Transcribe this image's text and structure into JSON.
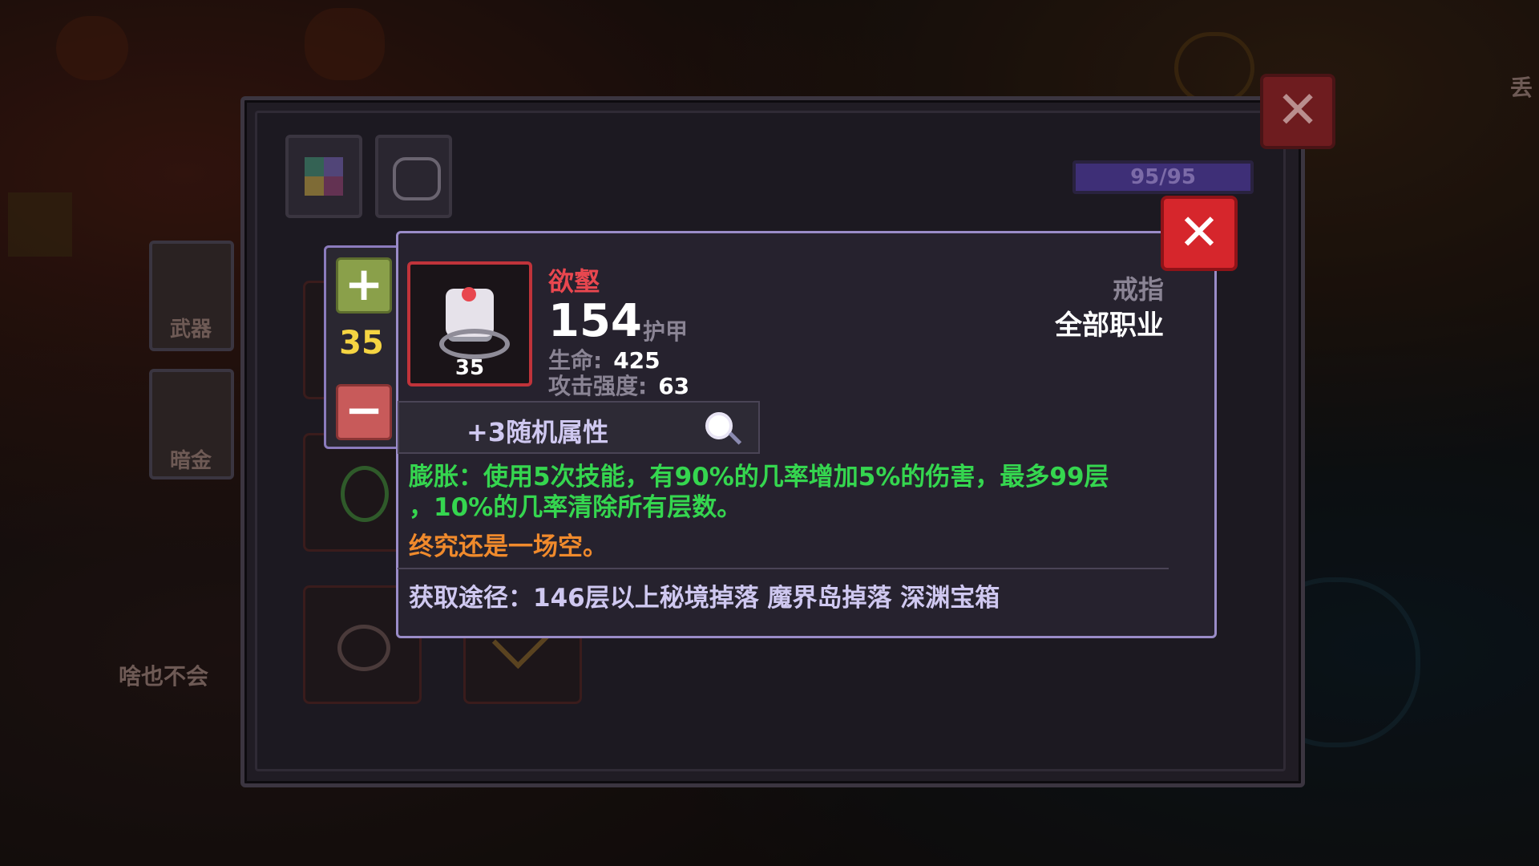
{
  "background": {
    "weapon_label": "武器",
    "dark_gold_label": "暗金",
    "bottom_text": "啥也不会",
    "right_edge_text": "丢"
  },
  "inventory": {
    "capacity": "95/95",
    "capacity_fill": 1.0
  },
  "quantity": {
    "plus_label": "+",
    "value": "35",
    "minus_label": "−"
  },
  "item": {
    "name": "欲壑",
    "level": "35",
    "main_value": "154",
    "main_label": "护甲",
    "stats": [
      {
        "label": "生命:",
        "value": "425"
      },
      {
        "label": "攻击强度:",
        "value": "63"
      }
    ],
    "type": "戒指",
    "class": "全部职业",
    "random_attr": "+3随机属性",
    "effect_line1": "膨胀：使用5次技能，有90%的几率增加5%的伤害，最多99层",
    "effect_line2": "，10%的几率清除所有层数。",
    "flavor": "终究还是一场空。",
    "source": "获取途径：146层以上秘境掉落 魔界岛掉落 深渊宝箱"
  },
  "colors": {
    "name": "#e8474f",
    "effect": "#35d64f",
    "flavor": "#f08a2c",
    "level": "#f5d442",
    "close": "#d6262c"
  }
}
